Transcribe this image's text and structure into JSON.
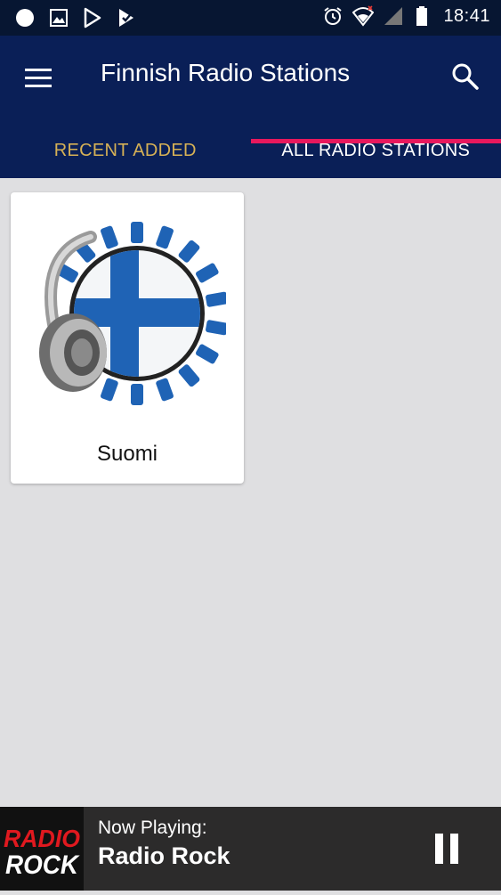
{
  "status_bar": {
    "time": "18:41",
    "icons": [
      "chat-bubble-icon",
      "image-icon",
      "play-store-icon",
      "downloaded-icon",
      "alarm-icon",
      "wifi-icon",
      "signal-icon",
      "battery-icon"
    ]
  },
  "app_bar": {
    "title": "Finnish Radio Stations",
    "menu_icon": "hamburger-menu-icon",
    "search_icon": "search-icon"
  },
  "tabs": [
    {
      "label": "RECENT ADDED",
      "selected": false,
      "color": "#d6b156"
    },
    {
      "label": "ALL RADIO STATIONS",
      "selected": true,
      "color": "#ffffff"
    }
  ],
  "tab_indicator_color": "#e8185d",
  "stations": [
    {
      "name": "Suomi",
      "icon": "finland-radio-headphones-logo"
    }
  ],
  "player": {
    "now_playing_label": "Now Playing:",
    "station": "Radio Rock",
    "logo_icon": "radio-rock-logo",
    "control_icon": "pause-icon"
  },
  "colors": {
    "status_bar_bg": "#071632",
    "app_bar_bg": "#0a1f57",
    "content_bg": "#dfdfe1",
    "player_bg": "#2c2b2b",
    "finland_blue": "#1f63b5"
  }
}
